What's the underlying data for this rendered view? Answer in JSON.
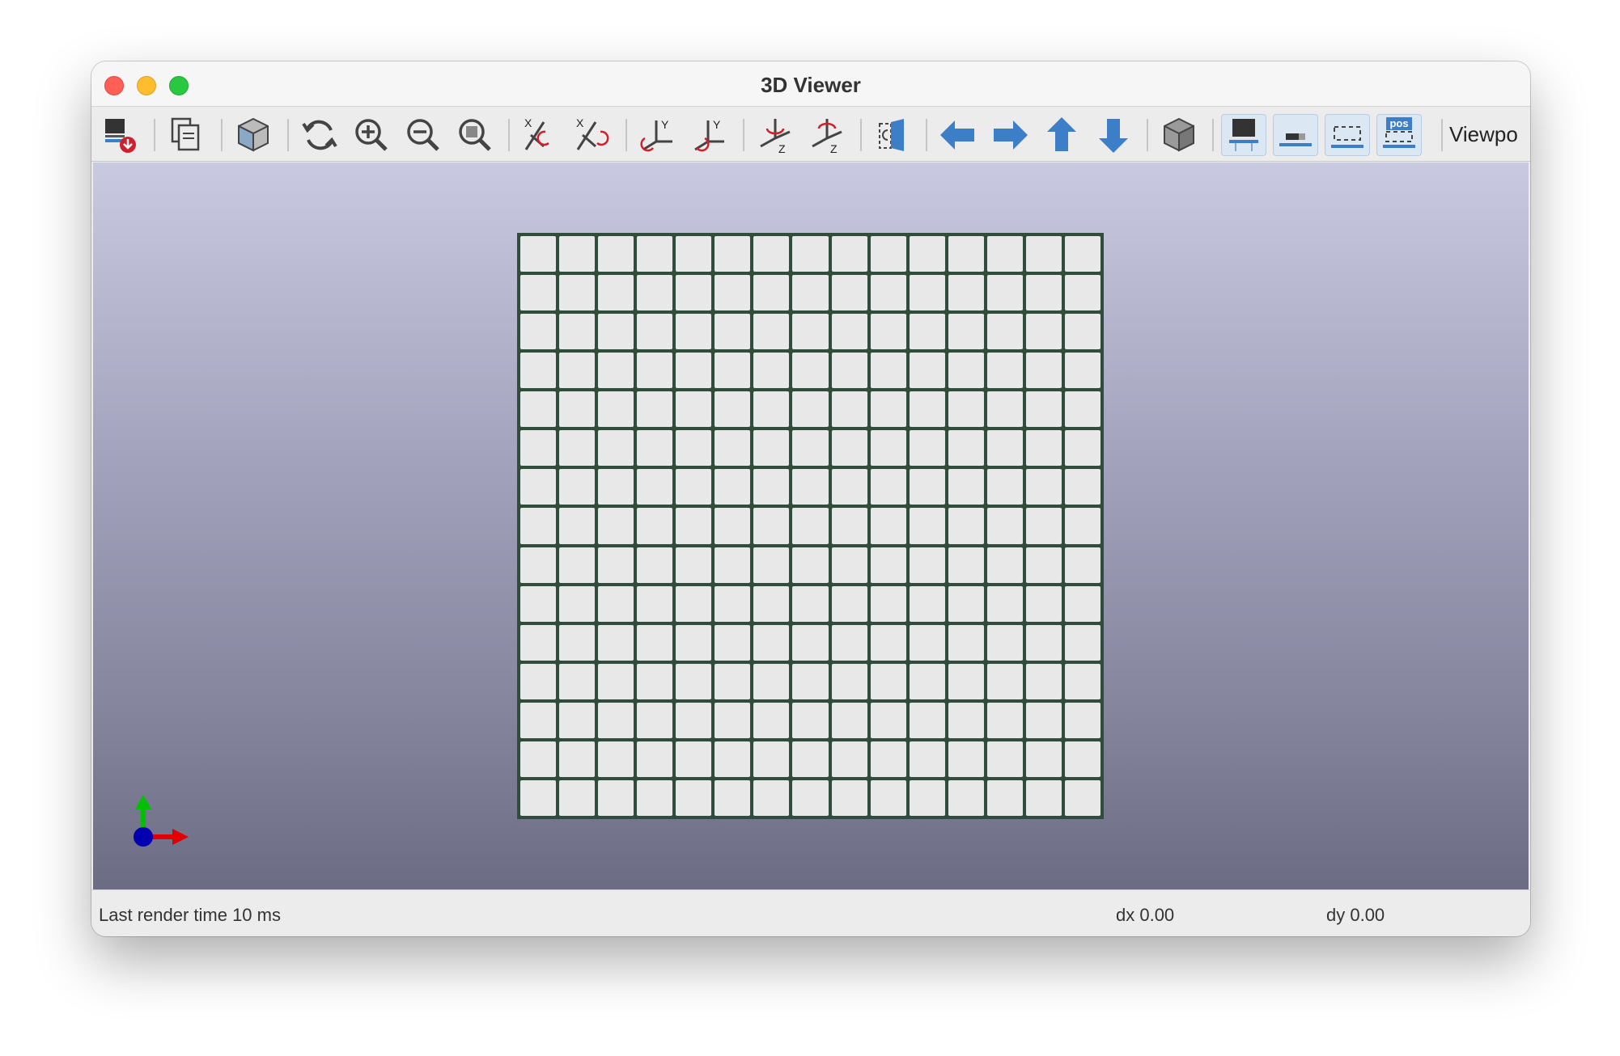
{
  "window": {
    "title": "3D Viewer"
  },
  "toolbar": {
    "items": [
      {
        "name": "render-settings-icon"
      },
      {
        "name": "copy-image-icon"
      },
      {
        "name": "view-cube-icon"
      },
      {
        "name": "refresh-icon"
      },
      {
        "name": "zoom-in-icon"
      },
      {
        "name": "zoom-out-icon"
      },
      {
        "name": "zoom-fit-icon"
      },
      {
        "name": "rotate-x-cw-icon"
      },
      {
        "name": "rotate-x-ccw-icon"
      },
      {
        "name": "rotate-y-cw-icon"
      },
      {
        "name": "rotate-y-ccw-icon"
      },
      {
        "name": "rotate-z-cw-icon"
      },
      {
        "name": "rotate-z-ccw-icon"
      },
      {
        "name": "flip-board-icon"
      },
      {
        "name": "pan-left-icon"
      },
      {
        "name": "pan-right-icon"
      },
      {
        "name": "pan-up-icon"
      },
      {
        "name": "pan-down-icon"
      },
      {
        "name": "orthographic-icon"
      },
      {
        "name": "show-tht-icon"
      },
      {
        "name": "show-smd-icon"
      },
      {
        "name": "show-virtual-icon"
      },
      {
        "name": "show-not-in-pos-icon"
      }
    ],
    "viewport_label": "Viewpo",
    "pos_badge": "pos",
    "axis_labels": {
      "x": "X",
      "y": "Y",
      "z": "Z"
    }
  },
  "board": {
    "rows": 15,
    "columns": 15
  },
  "status": {
    "render_time": "Last render time 10 ms",
    "dx": "dx 0.00",
    "dy": "dy 0.00"
  },
  "colors": {
    "pan_arrow": "#3d7ec9",
    "grid_line": "#2f4d3a",
    "cell": "#e8e8e8",
    "axis_x": "#e00000",
    "axis_y": "#00c000",
    "axis_z": "#0000b0"
  }
}
